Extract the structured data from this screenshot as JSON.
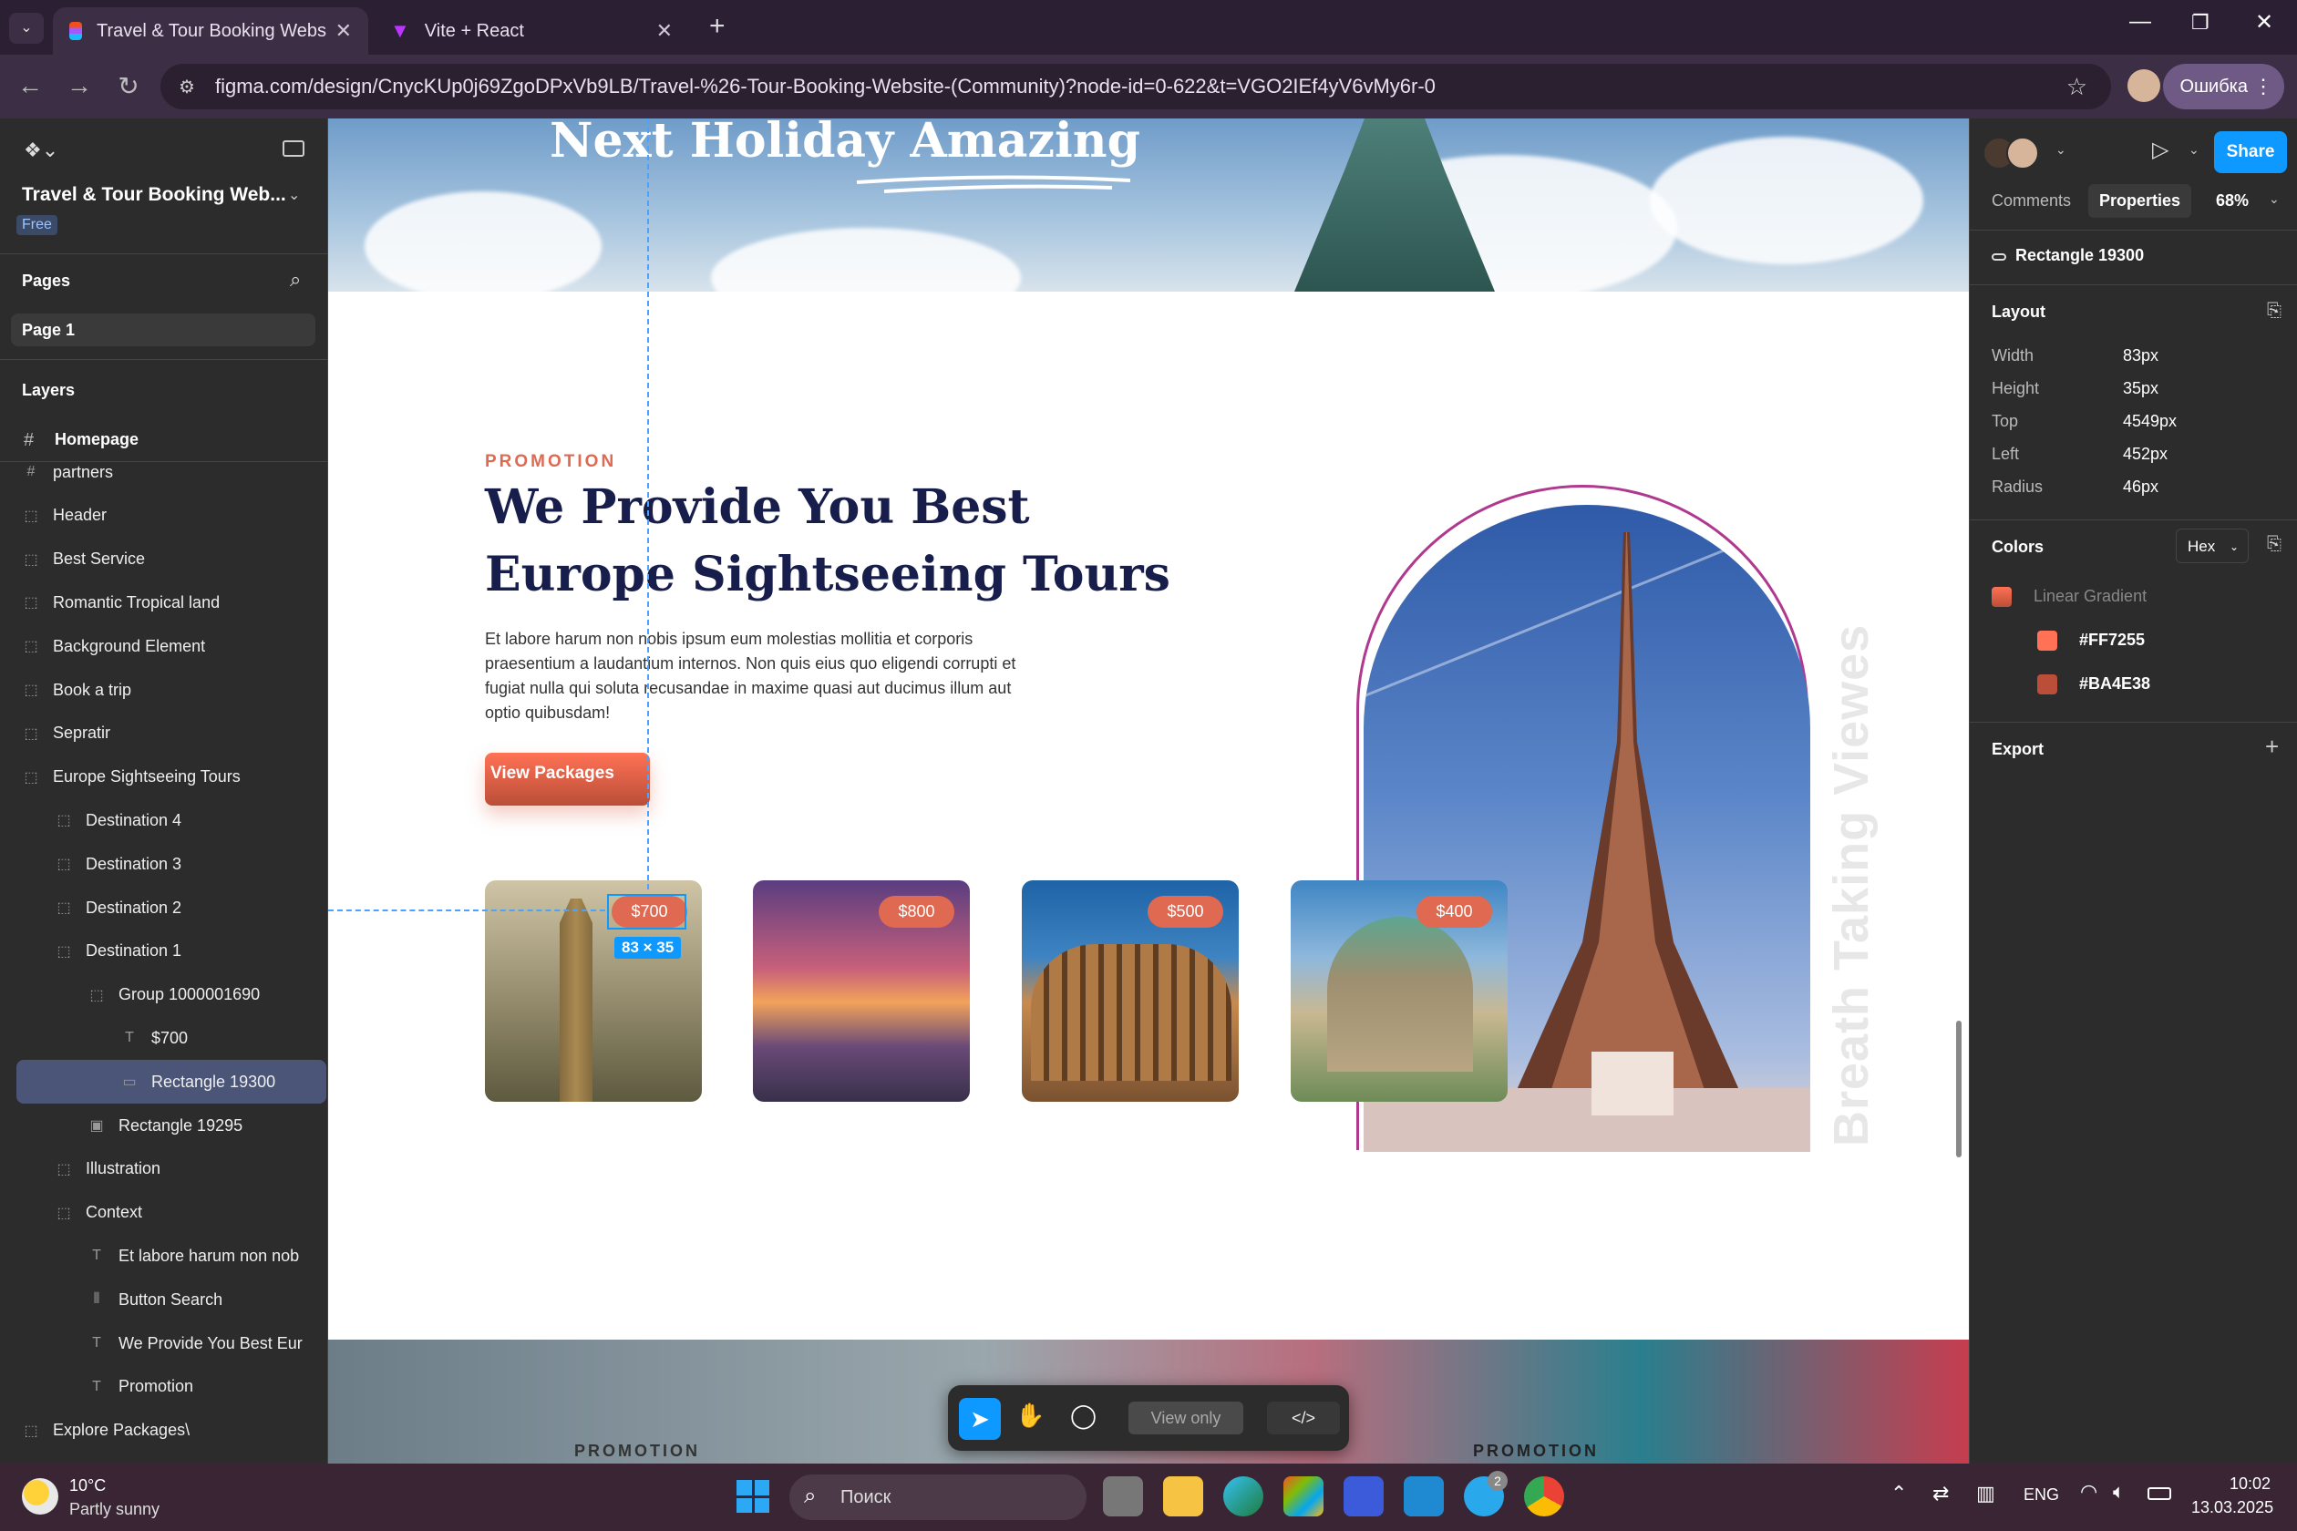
{
  "browser": {
    "tabs": [
      {
        "title": "Travel & Tour Booking Website",
        "active": true
      },
      {
        "title": "Vite + React",
        "active": false
      }
    ],
    "url": "figma.com/design/CnycKUp0j69ZgoDPxVb9LB/Travel-%26-Tour-Booking-Website-(Community)?node-id=0-622&t=VGO2IEf4yV6vMy6r-0",
    "profile_label": "Ошибка"
  },
  "figma": {
    "file_name": "Travel & Tour Booking Web...",
    "plan_badge": "Free",
    "pages_label": "Pages",
    "page_1": "Page 1",
    "layers_label": "Layers",
    "frame_name": "Homepage",
    "layers": [
      {
        "name": "partners",
        "icon": "frame-icon",
        "indent": 1
      },
      {
        "name": "Header",
        "icon": "group-icon",
        "indent": 1
      },
      {
        "name": "Best Service",
        "icon": "group-icon",
        "indent": 1
      },
      {
        "name": "Romantic Tropical land",
        "icon": "group-icon",
        "indent": 1
      },
      {
        "name": "Background Element",
        "icon": "group-icon",
        "indent": 1
      },
      {
        "name": "Book a trip",
        "icon": "group-icon",
        "indent": 1
      },
      {
        "name": "Sepratir",
        "icon": "group-icon",
        "indent": 1
      },
      {
        "name": "Europe Sightseeing Tours",
        "icon": "group-icon",
        "indent": 1
      },
      {
        "name": "Destination 4",
        "icon": "group-icon",
        "indent": 2
      },
      {
        "name": "Destination 3",
        "icon": "group-icon",
        "indent": 2
      },
      {
        "name": "Destination 2",
        "icon": "group-icon",
        "indent": 2
      },
      {
        "name": "Destination 1",
        "icon": "group-icon",
        "indent": 2
      },
      {
        "name": "Group 1000001690",
        "icon": "group-icon",
        "indent": 3
      },
      {
        "name": "$700",
        "icon": "text-icon",
        "indent": 4
      },
      {
        "name": "Rectangle 19300",
        "icon": "rectangle-icon",
        "indent": 4,
        "selected": true
      },
      {
        "name": "Rectangle 19295",
        "icon": "image-icon",
        "indent": 3
      },
      {
        "name": "Illustration",
        "icon": "group-icon",
        "indent": 2
      },
      {
        "name": "Context",
        "icon": "group-icon",
        "indent": 2
      },
      {
        "name": "Et labore harum non nob",
        "icon": "text-icon",
        "indent": 3
      },
      {
        "name": "Button Search",
        "icon": "autolayout-icon",
        "indent": 3
      },
      {
        "name": "We Provide You Best Eur",
        "icon": "text-icon",
        "indent": 3
      },
      {
        "name": "Promotion",
        "icon": "text-icon",
        "indent": 3
      },
      {
        "name": "Explore Packages\\",
        "icon": "group-icon",
        "indent": 1
      }
    ],
    "right": {
      "share": "Share",
      "tab_comments": "Comments",
      "tab_properties": "Properties",
      "zoom": "68%",
      "selection_name": "Rectangle 19300",
      "layout_label": "Layout",
      "width_label": "Width",
      "width_value": "83px",
      "height_label": "Height",
      "height_value": "35px",
      "top_label": "Top",
      "top_value": "4549px",
      "left_label": "Left",
      "left_value": "452px",
      "radius_label": "Radius",
      "radius_value": "46px",
      "colors_label": "Colors",
      "color_format": "Hex",
      "gradient_label": "Linear Gradient",
      "color_1": "#FF7255",
      "color_2": "#BA4E38",
      "export_label": "Export"
    },
    "toolbar": {
      "view_only": "View only"
    },
    "size_badge": "83 × 35"
  },
  "design": {
    "hero_title": "Next Holiday Amazing",
    "promotion": "PROMOTION",
    "heading_line1": "We Provide You Best",
    "heading_line2": "Europe Sightseeing Tours",
    "paragraph": "Et labore harum non nobis ipsum eum molestias mollitia et corporis praesentium a laudantium internos. Non quis eius quo eligendi corrupti et fugiat nulla qui soluta recusandae in maxime quasi aut ducimus illum aut optio quibusdam!",
    "button": "View Packages",
    "destinations": [
      {
        "price": "$700"
      },
      {
        "price": "$800"
      },
      {
        "price": "$500"
      },
      {
        "price": "$400"
      }
    ],
    "vertical_text": "Breath Taking Viewes",
    "bottom_promo": "PROMOTION"
  },
  "taskbar": {
    "weather_temp": "10°C",
    "weather_desc": "Partly sunny",
    "search_placeholder": "Поиск",
    "language": "ENG",
    "time": "10:02",
    "date": "13.03.2025",
    "telegram_badge": "2"
  },
  "colors": {
    "accent": "#df6951",
    "figma_blue": "#0d99ff",
    "navy": "#181e4b"
  }
}
